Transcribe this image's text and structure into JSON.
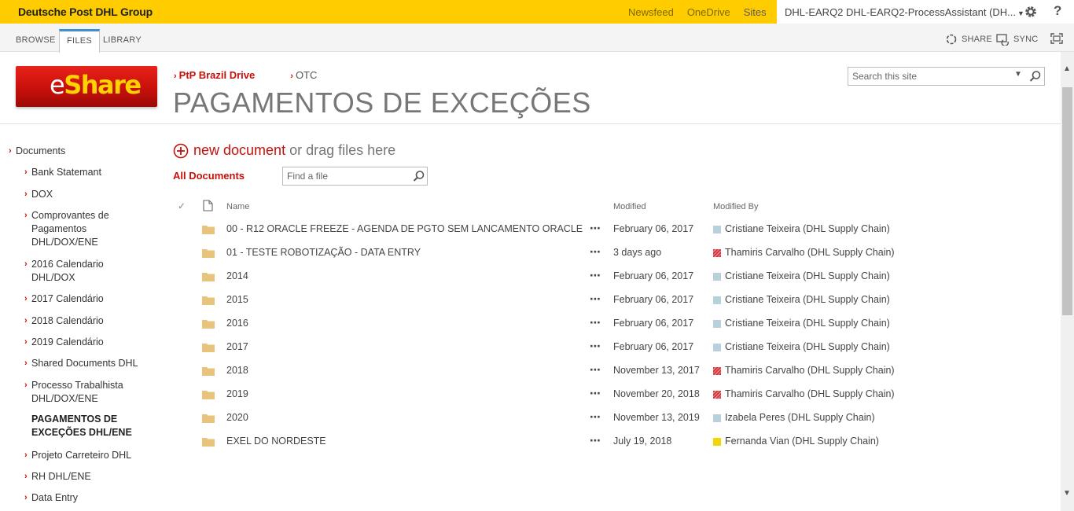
{
  "suitebar": {
    "brand": "Deutsche Post DHL Group",
    "links": [
      "Newsfeed",
      "OneDrive",
      "Sites"
    ],
    "user": "DHL-EARQ2 DHL-EARQ2-ProcessAssistant (DH...",
    "accent": "#ffcc00"
  },
  "ribbon": {
    "tabs": [
      "BROWSE",
      "FILES",
      "LIBRARY"
    ],
    "share": "SHARE",
    "sync": "SYNC"
  },
  "header": {
    "logo_e": "e",
    "logo_share": "Share",
    "crumb1": "PtP Brazil Drive",
    "crumb2": "OTC",
    "title": "PAGAMENTOS DE EXCEÇÕES",
    "search_placeholder": "Search this site"
  },
  "nav": {
    "root": "Documents",
    "items": [
      "Bank Statemant",
      "DOX",
      "Comprovantes de Pagamentos DHL/DOX/ENE",
      "2016 Calendario DHL/DOX",
      "2017 Calendário",
      "2018 Calendário",
      "2019 Calendário",
      "Shared Documents DHL",
      "Processo Trabalhista DHL/DOX/ENE",
      "PAGAMENTOS DE EXCEÇÕES DHL/ENE",
      "Projeto Carreteiro DHL",
      "RH DHL/ENE",
      "Data Entry"
    ]
  },
  "content": {
    "new_doc_link": "new document",
    "new_doc_rest": "or drag files here",
    "view": "All Documents",
    "find_placeholder": "Find a file",
    "columns": {
      "name": "Name",
      "modified": "Modified",
      "modified_by": "Modified By"
    },
    "rows": [
      {
        "name": "00 - R12 ORACLE FREEZE - AGENDA DE PGTO SEM LANCAMENTO ORACLE",
        "modified": "February 06, 2017",
        "by": "Cristiane Teixeira (DHL Supply Chain)",
        "presence": "blue"
      },
      {
        "name": "01 - TESTE ROBOTIZAÇÃO - DATA ENTRY",
        "modified": "3 days ago",
        "by": "Thamiris Carvalho (DHL Supply Chain)",
        "presence": "red"
      },
      {
        "name": "2014",
        "modified": "February 06, 2017",
        "by": "Cristiane Teixeira (DHL Supply Chain)",
        "presence": "blue"
      },
      {
        "name": "2015",
        "modified": "February 06, 2017",
        "by": "Cristiane Teixeira (DHL Supply Chain)",
        "presence": "blue"
      },
      {
        "name": "2016",
        "modified": "February 06, 2017",
        "by": "Cristiane Teixeira (DHL Supply Chain)",
        "presence": "blue"
      },
      {
        "name": "2017",
        "modified": "February 06, 2017",
        "by": "Cristiane Teixeira (DHL Supply Chain)",
        "presence": "blue"
      },
      {
        "name": "2018",
        "modified": "November 13, 2017",
        "by": "Thamiris Carvalho (DHL Supply Chain)",
        "presence": "red"
      },
      {
        "name": "2019",
        "modified": "November 20, 2018",
        "by": "Thamiris Carvalho (DHL Supply Chain)",
        "presence": "red"
      },
      {
        "name": "2020",
        "modified": "November 13, 2019",
        "by": "Izabela Peres (DHL Supply Chain)",
        "presence": "blue"
      },
      {
        "name": "EXEL DO NORDESTE",
        "modified": "July 19, 2018",
        "by": "Fernanda Vian (DHL Supply Chain)",
        "presence": "yellow"
      }
    ]
  },
  "colors": {
    "brand_red": "#c8100b",
    "presence_blue": "#b7d0dc",
    "presence_red": "#d9363e",
    "presence_yellow": "#f2d600",
    "folder": "#e8c37c"
  }
}
